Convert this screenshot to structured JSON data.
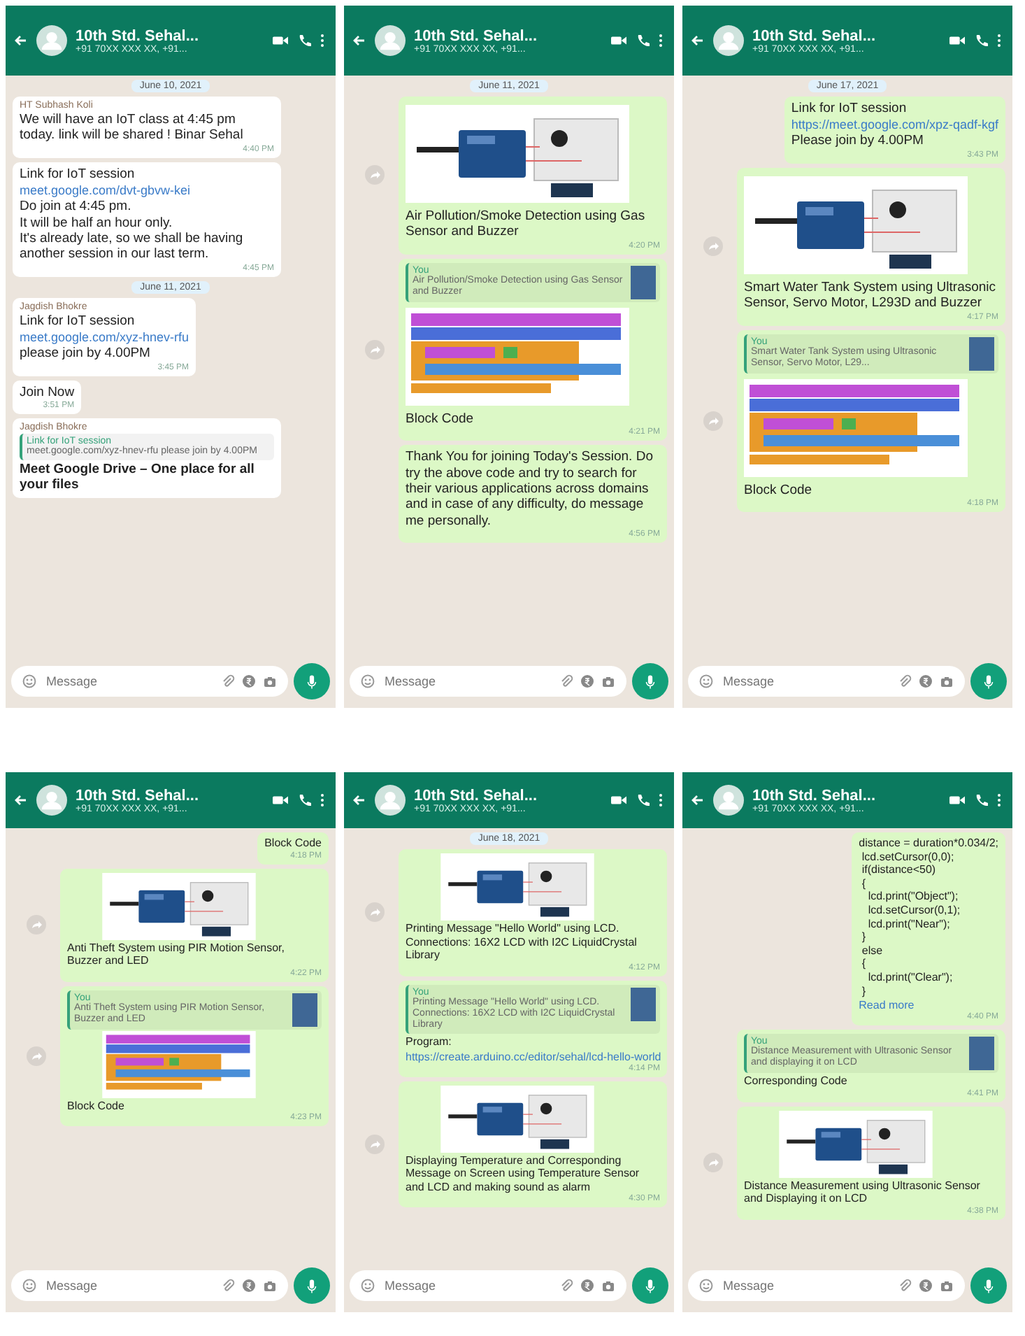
{
  "panels": [
    {
      "title": "10th Std. Sehal...",
      "subtitle": "+91 70XX XXX XX, +91...",
      "placeholder": "Message",
      "messages": [
        {
          "kind": "date",
          "text": "June 10, 2021"
        },
        {
          "kind": "text",
          "outgoing": false,
          "sender": "HT Subhash Koli",
          "text": "We will have an IoT class at 4:45 pm today. link will be shared ! Binar Sehal",
          "time": "4:40 PM"
        },
        {
          "kind": "text",
          "outgoing": false,
          "text": "Link for IoT session",
          "link": "meet.google.com/dvt-gbvw-kei",
          "after": "Do join at 4:45 pm.\nIt will be half an hour only.\nIt's already late, so we shall be having another session in our last term.",
          "time": "4:45 PM"
        },
        {
          "kind": "date",
          "text": "June 11, 2021"
        },
        {
          "kind": "text",
          "outgoing": false,
          "sender": "Jagdish Bhokre",
          "text": "Link for IoT session",
          "link": "meet.google.com/xyz-hnev-rfu",
          "after": "please join by 4.00PM",
          "time": "3:45 PM"
        },
        {
          "kind": "text",
          "outgoing": false,
          "text": "Join Now",
          "time": "3:51 PM"
        },
        {
          "kind": "text",
          "outgoing": false,
          "sender": "Jagdish Bhokre",
          "quote": {
            "author": "Link for IoT session",
            "text": "meet.google.com/xyz-hnev-rfu please join by 4.00PM"
          },
          "text": "Meet Google Drive – One place for all your files",
          "bold": true
        }
      ]
    },
    {
      "title": "10th Std. Sehal...",
      "subtitle": "+91 70XX XXX XX, +91...",
      "placeholder": "Message",
      "messages": [
        {
          "kind": "date",
          "text": "June 11, 2021"
        },
        {
          "kind": "image",
          "outgoing": true,
          "caption": "Air Pollution/Smoke Detection using Gas Sensor and Buzzer",
          "time": "4:20 PM"
        },
        {
          "kind": "blocks",
          "outgoing": true,
          "quote": {
            "author": "You",
            "text": "Air Pollution/Smoke Detection using Gas Sensor and Buzzer"
          },
          "caption": "Block Code",
          "time": "4:21 PM"
        },
        {
          "kind": "text",
          "outgoing": true,
          "text": "Thank You for joining Today's Session. Do try the above code and try to search for their various applications across domains and in case of any difficulty, do message me personally.",
          "time": "4:56 PM"
        }
      ]
    },
    {
      "title": "10th Std. Sehal...",
      "subtitle": "+91 70XX XXX XX, +91...",
      "placeholder": "Message",
      "messages": [
        {
          "kind": "date",
          "text": "June 17, 2021"
        },
        {
          "kind": "text",
          "outgoing": true,
          "text": "Link for IoT session",
          "link": "https://meet.google.com/xpz-qadf-kgf",
          "after": "Please join by 4.00PM",
          "time": "3:43 PM"
        },
        {
          "kind": "image",
          "outgoing": true,
          "caption": "Smart Water Tank System using Ultrasonic Sensor, Servo Motor, L293D and Buzzer",
          "time": "4:17 PM"
        },
        {
          "kind": "blocks",
          "outgoing": true,
          "quote": {
            "author": "You",
            "text": "Smart Water Tank System using Ultrasonic Sensor, Servo Motor, L29..."
          },
          "caption": "Block Code",
          "time": "4:18 PM"
        }
      ]
    },
    {
      "title": "10th Std. Sehal...",
      "subtitle": "+91 70XX XXX XX, +91...",
      "placeholder": "Message",
      "messages": [
        {
          "kind": "text",
          "outgoing": true,
          "text": "Block Code",
          "time": "4:18 PM"
        },
        {
          "kind": "image",
          "outgoing": true,
          "caption": "Anti Theft System using PIR Motion Sensor, Buzzer and LED",
          "time": "4:22 PM"
        },
        {
          "kind": "blocks",
          "outgoing": true,
          "quote": {
            "author": "You",
            "text": "Anti Theft System using PIR Motion Sensor, Buzzer and LED"
          },
          "caption": "Block Code",
          "time": "4:23 PM"
        }
      ]
    },
    {
      "title": "10th Std. Sehal...",
      "subtitle": "+91 70XX XXX XX, +91...",
      "placeholder": "Message",
      "messages": [
        {
          "kind": "date",
          "text": "June 18, 2021"
        },
        {
          "kind": "image",
          "outgoing": true,
          "caption": "Printing Message \"Hello World\" using LCD. Connections: 16X2 LCD with I2C LiquidCrystal Library",
          "time": "4:12 PM"
        },
        {
          "kind": "text",
          "outgoing": true,
          "quote": {
            "author": "You",
            "text": "Printing Message \"Hello World\" using LCD. Connections: 16X2 LCD with I2C LiquidCrystal Library"
          },
          "text": "Program:",
          "link": "https://create.arduino.cc/editor/sehal/lcd-hello-world",
          "time": "4:14 PM"
        },
        {
          "kind": "image",
          "outgoing": true,
          "caption": "Displaying Temperature and Corresponding Message on Screen using Temperature Sensor and LCD and making sound as alarm",
          "time": "4:30 PM"
        }
      ]
    },
    {
      "title": "10th Std. Sehal...",
      "subtitle": "+91 70XX XXX XX, +91...",
      "placeholder": "Message",
      "messages": [
        {
          "kind": "text",
          "outgoing": true,
          "text": "distance = duration*0.034/2;\n lcd.setCursor(0,0);\n if(distance<50)\n {\n   lcd.print(\"Object\");\n   lcd.setCursor(0,1);\n   lcd.print(\"Near\");\n }\n else\n {\n   lcd.print(\"Clear\");\n }",
          "link": "Read more",
          "time": "4:40 PM"
        },
        {
          "kind": "text",
          "outgoing": true,
          "quote": {
            "author": "You",
            "text": "Distance Measurement with Ultrasonic Sensor and displaying it on LCD"
          },
          "text": "Corresponding Code",
          "time": "4:41 PM"
        },
        {
          "kind": "image",
          "outgoing": true,
          "caption": "Distance Measurement using Ultrasonic Sensor and Displaying it on LCD",
          "time": "4:38 PM"
        }
      ]
    }
  ]
}
